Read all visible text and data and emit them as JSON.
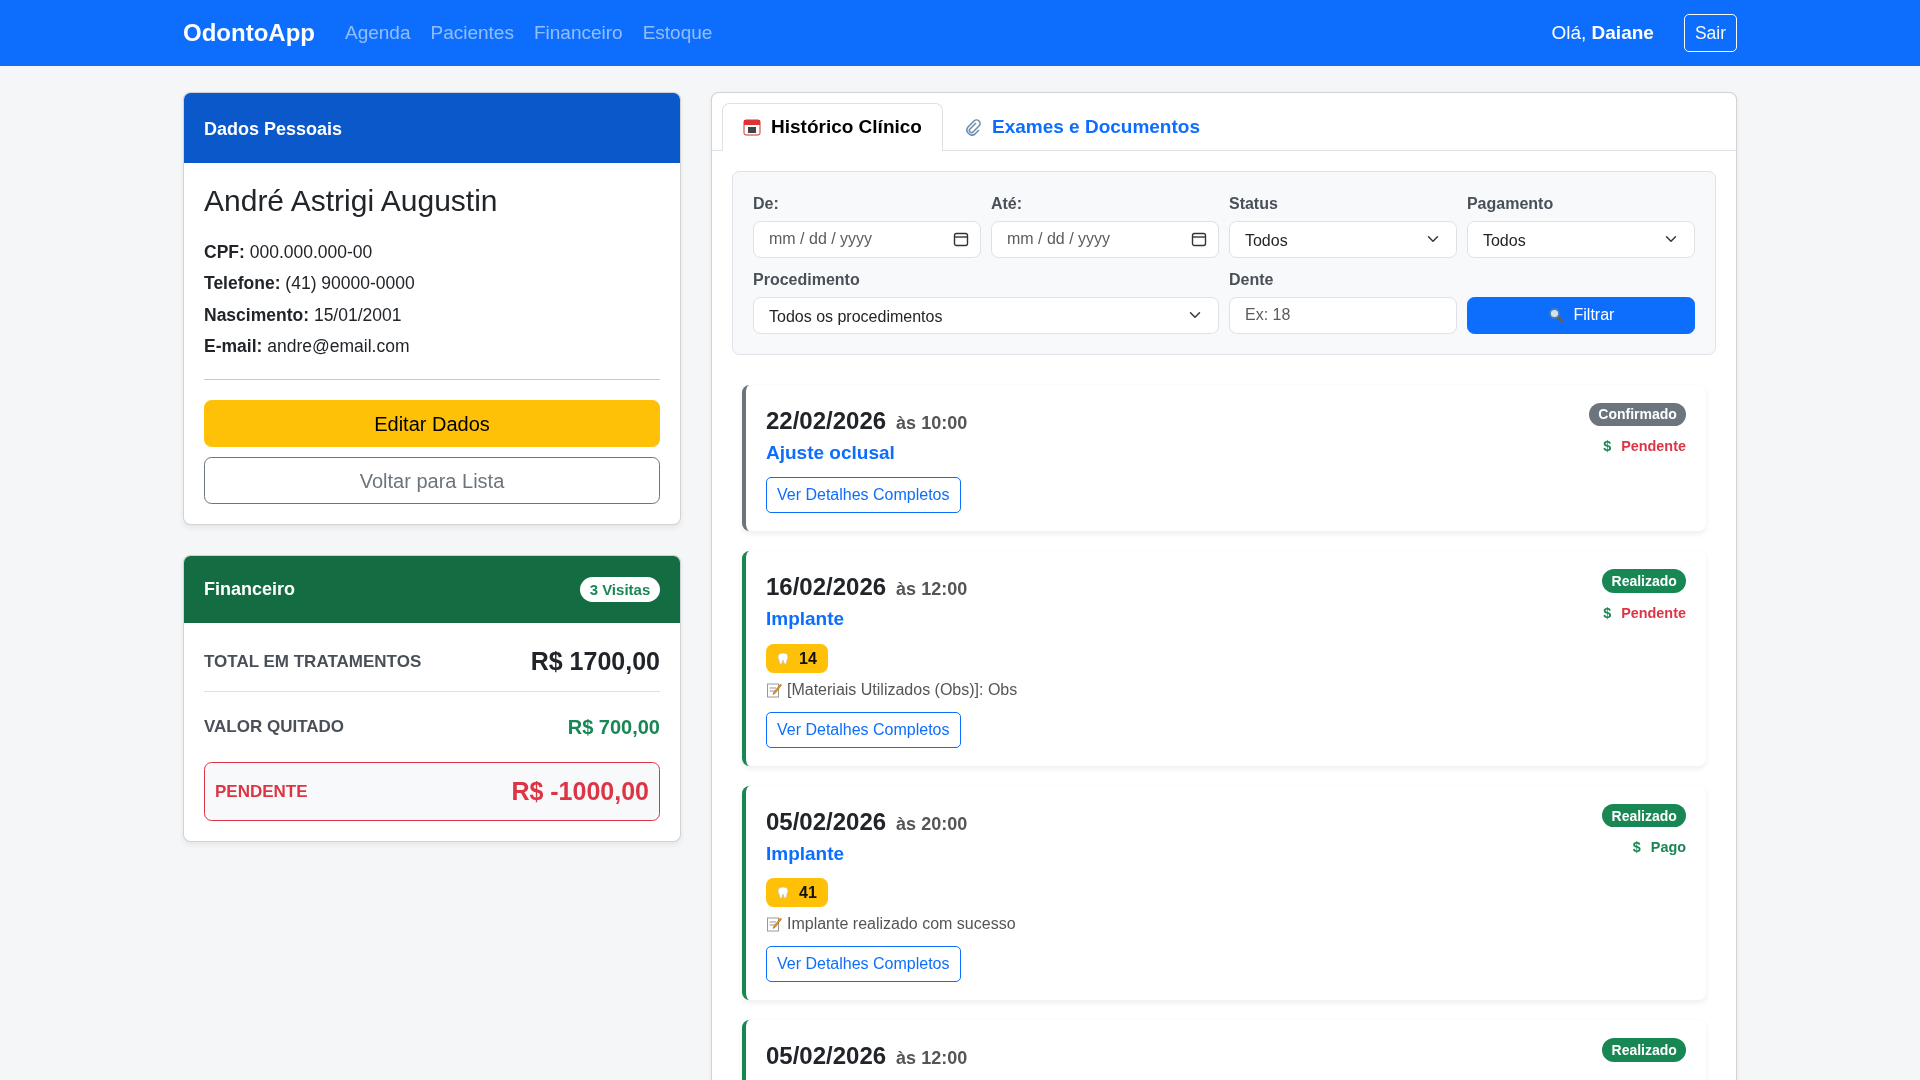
{
  "navbar": {
    "brand": "OdontoApp",
    "links": [
      {
        "label": "Agenda",
        "selected": false
      },
      {
        "label": "Pacientes",
        "selected": false
      },
      {
        "label": "Financeiro",
        "selected": false
      },
      {
        "label": "Estoque",
        "selected": false
      }
    ],
    "greeting": "Olá, **Daiane**",
    "logout": "Sair"
  },
  "personal": {
    "header": "Dados Pessoais",
    "name": "André Astrigi Augustin",
    "fields": [
      {
        "label": "CPF:",
        "value": "000.000.000-00"
      },
      {
        "label": "Telefone:",
        "value": "(41) 90000-0000"
      },
      {
        "label": "Nascimento:",
        "value": "15/01/2001"
      },
      {
        "label": "E-mail:",
        "value": "andre@email.com"
      }
    ],
    "edit_button": "Editar Dados",
    "back_button": "Voltar para Lista"
  },
  "finance": {
    "header": "Financeiro",
    "visits": "3 Visitas",
    "total_label": "TOTAL EM TRATAMENTOS",
    "total_value": "R$ 1700,00",
    "paid_label": "VALOR QUITADO",
    "paid_value": "R$ 700,00",
    "pending_label": "PENDENTE",
    "pending_value": "R$ -1000,00"
  },
  "tabs": [
    {
      "label": "Histórico Clínico",
      "selected": true
    },
    {
      "label": "Exames e Documentos",
      "selected": false
    }
  ],
  "filters": {
    "from": {
      "label": "De:",
      "placeholder": "mm / dd / yyyy"
    },
    "to": {
      "label": "Até:",
      "placeholder": "mm / dd / yyyy"
    },
    "status": {
      "label": "Status",
      "value": "Todos"
    },
    "payment": {
      "label": "Pagamento",
      "value": "Todos"
    },
    "procedure": {
      "label": "Procedimento",
      "value": "Todos os procedimentos"
    },
    "tooth": {
      "label": "Dente",
      "placeholder": "Ex: 18"
    },
    "button": "Filtrar"
  },
  "entries": [
    {
      "date": "22/02/2026",
      "time": "às 10:00",
      "procedure": "Ajuste oclusal",
      "status": "Confirmado",
      "color": "#6c757d",
      "payment": {
        "symbol": "$",
        "label": "Pendente",
        "paid": false
      },
      "details_button": "Ver Detalhes Completos"
    },
    {
      "date": "16/02/2026",
      "time": "às 12:00",
      "procedure": "Implante",
      "status": "Realizado",
      "color": "#198754",
      "payment": {
        "symbol": "$",
        "label": "Pendente",
        "paid": false
      },
      "tooth": "14",
      "notes": "[Materiais Utilizados (Obs)]: Obs",
      "details_button": "Ver Detalhes Completos"
    },
    {
      "date": "05/02/2026",
      "time": "às 20:00",
      "procedure": "Implante",
      "status": "Realizado",
      "color": "#198754",
      "payment": {
        "symbol": "$",
        "label": "Pago",
        "paid": true
      },
      "tooth": "41",
      "notes": "Implante realizado com sucesso",
      "details_button": "Ver Detalhes Completos"
    },
    {
      "date": "05/02/2026",
      "time": "às 12:00",
      "status": "Realizado",
      "color": "#198754"
    }
  ]
}
